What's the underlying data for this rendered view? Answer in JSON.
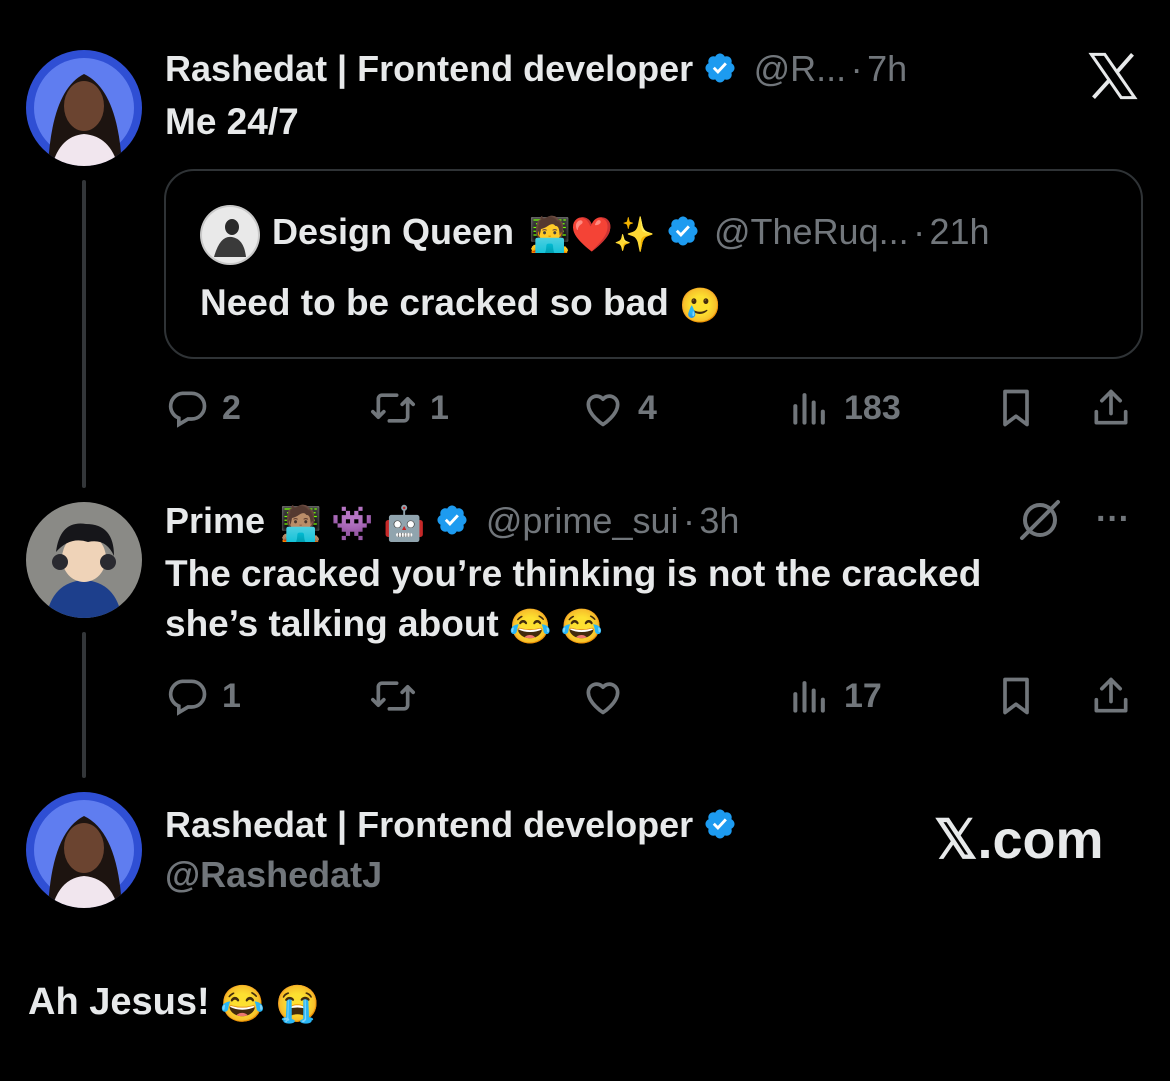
{
  "tweet1": {
    "author_name": "Rashedat | Frontend developer",
    "handle": "@R...",
    "sep": "·",
    "time": "7h",
    "text": "Me 24/7",
    "quote": {
      "author_name": "Design Queen",
      "emojis": "🧑‍💻❤️✨",
      "handle": "@TheRuq...",
      "sep": "·",
      "time": "21h",
      "text": "Need to be cracked so bad",
      "text_emoji": "🥲"
    },
    "actions": {
      "replies": "2",
      "reposts": "1",
      "likes": "4",
      "views": "183"
    }
  },
  "tweet2": {
    "author_name": "Prime",
    "emojis": "🧑🏽‍💻 👾 🤖",
    "handle": "@prime_sui",
    "sep": "·",
    "time": "3h",
    "more": "···",
    "text_line1": "The cracked you’re thinking is not the cracked",
    "text_line2": "she’s talking about",
    "text_emoji": "😂 😂",
    "actions": {
      "replies": "1",
      "reposts": "",
      "likes": "",
      "views": "17"
    }
  },
  "card": {
    "author_name": "Rashedat | Frontend developer",
    "handle": "@RashedatJ",
    "brand": "𝕏.com"
  },
  "caption": {
    "text": "Ah Jesus!",
    "emoji": "😂 😭"
  },
  "colors": {
    "background": "#000000",
    "text": "#e7e9ea",
    "muted": "#71767b",
    "verified": "#1d9bf0",
    "border": "#2f3336"
  },
  "icons": [
    "x-logo-icon",
    "verified-badge-icon",
    "reply-icon",
    "repost-icon",
    "like-icon",
    "views-icon",
    "bookmark-icon",
    "share-icon",
    "grok-icon",
    "more-icon"
  ]
}
